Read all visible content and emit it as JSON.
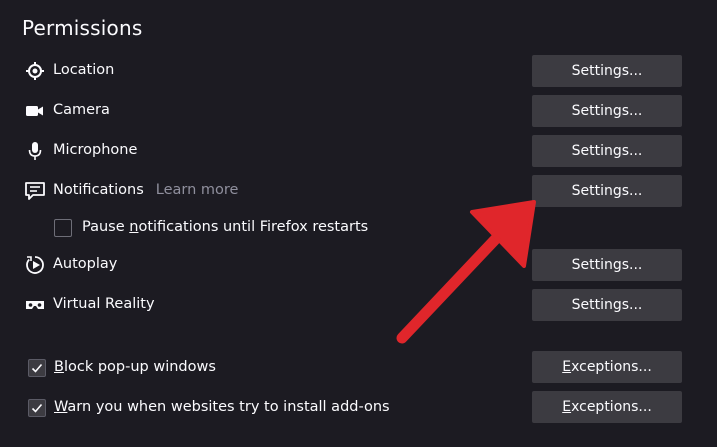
{
  "section": {
    "title": "Permissions"
  },
  "permissions": [
    {
      "id": "location",
      "label": "Location",
      "icon": "location-icon",
      "button": "Settings..."
    },
    {
      "id": "camera",
      "label": "Camera",
      "icon": "camera-icon",
      "button": "Settings..."
    },
    {
      "id": "microphone",
      "label": "Microphone",
      "icon": "microphone-icon",
      "button": "Settings..."
    },
    {
      "id": "notifications",
      "label": "Notifications",
      "icon": "notifications-icon",
      "button": "Settings...",
      "learn_more": "Learn more"
    },
    {
      "id": "autoplay",
      "label": "Autoplay",
      "icon": "autoplay-icon",
      "button": "Settings..."
    },
    {
      "id": "vr",
      "label": "Virtual Reality",
      "icon": "vr-headset-icon",
      "button": "Settings..."
    }
  ],
  "pause_notifications": {
    "pre": "Pause ",
    "accesskey": "n",
    "post": "otifications until Firefox restarts",
    "checked": false
  },
  "block_popups": {
    "accesskey": "B",
    "post": "lock pop-up windows",
    "checked": true,
    "button_pre": "",
    "button_accesskey": "E",
    "button_post": "xceptions..."
  },
  "warn_addons": {
    "accesskey": "W",
    "post": "arn you when websites try to install add-ons",
    "checked": true,
    "button_pre": "",
    "button_accesskey": "E",
    "button_post": "xceptions..."
  },
  "colors": {
    "background": "#1c1b22",
    "button": "#3c3b41",
    "text": "#fbfbfe",
    "muted": "#8f8f9d",
    "annotation_arrow": "#e0262b"
  }
}
